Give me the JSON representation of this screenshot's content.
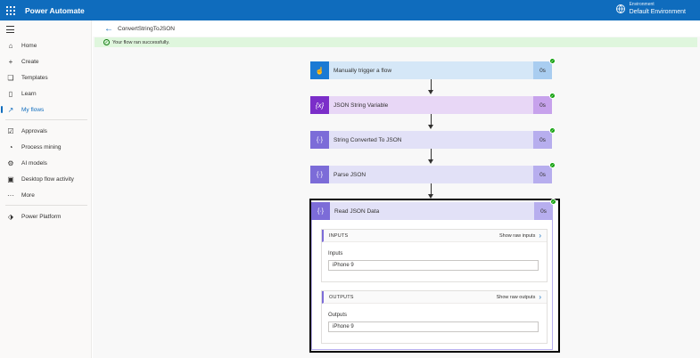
{
  "app": {
    "title": "Power Automate"
  },
  "environment": {
    "label": "Environment",
    "name": "Default Environment"
  },
  "nav": {
    "items": [
      {
        "label": "Home",
        "icon": "⌂"
      },
      {
        "label": "Create",
        "icon": "+"
      },
      {
        "label": "Templates",
        "icon": "❏"
      },
      {
        "label": "Learn",
        "icon": "▯"
      },
      {
        "label": "My flows",
        "icon": "↗"
      },
      {
        "label": "Approvals",
        "icon": "☑"
      },
      {
        "label": "Process mining",
        "icon": "◔"
      },
      {
        "label": "AI models",
        "icon": "⚙"
      },
      {
        "label": "Desktop flow activity",
        "icon": "▣"
      },
      {
        "label": "More",
        "icon": "···"
      },
      {
        "label": "Power Platform",
        "icon": "⬗"
      }
    ]
  },
  "flow": {
    "name": "ConvertStringToJSON",
    "status_message": "Your flow ran successfully."
  },
  "steps": [
    {
      "label": "Manually trigger a flow",
      "duration": "0s",
      "icon": "☝"
    },
    {
      "label": "JSON String Variable",
      "duration": "0s",
      "icon": "{x}"
    },
    {
      "label": "String Converted To JSON",
      "duration": "0s",
      "icon": "{·}"
    },
    {
      "label": "Parse JSON",
      "duration": "0s",
      "icon": "{·}"
    },
    {
      "label": "Read JSON Data",
      "duration": "0s",
      "icon": "{·}"
    }
  ],
  "details": {
    "inputs": {
      "header": "INPUTS",
      "raw_link": "Show raw inputs",
      "field_label": "Inputs",
      "value": "iPhone  9"
    },
    "outputs": {
      "header": "OUTPUTS",
      "raw_link": "Show raw outputs",
      "field_label": "Outputs",
      "value": "iPhone  9"
    }
  },
  "colors": {
    "brand": "#0f6cbd",
    "success": "#13a10e",
    "trigger": "#1a7ad4",
    "variable": "#7b2ec9",
    "data_operation": "#7c6cd8"
  }
}
